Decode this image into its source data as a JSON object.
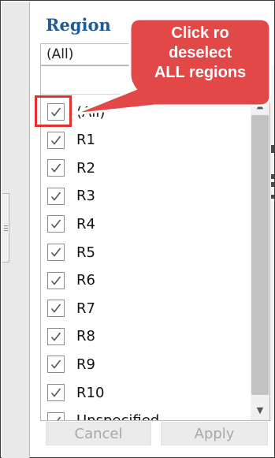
{
  "filter": {
    "title": "Region",
    "selected_value": "(All)"
  },
  "items": [
    {
      "label": "(All)",
      "checked": true
    },
    {
      "label": "R1",
      "checked": true
    },
    {
      "label": "R2",
      "checked": true
    },
    {
      "label": "R3",
      "checked": true
    },
    {
      "label": "R4",
      "checked": true
    },
    {
      "label": "R5",
      "checked": true
    },
    {
      "label": "R6",
      "checked": true
    },
    {
      "label": "R7",
      "checked": true
    },
    {
      "label": "R8",
      "checked": true
    },
    {
      "label": "R9",
      "checked": true
    },
    {
      "label": "R10",
      "checked": true
    },
    {
      "label": "Unspecified",
      "checked": true
    }
  ],
  "buttons": {
    "cancel": "Cancel",
    "apply": "Apply",
    "enabled": false
  },
  "callout": {
    "lines": [
      "Click ro",
      "deselect",
      "ALL regions"
    ]
  },
  "colors": {
    "title": "#1f5a99",
    "callout_fill": "#e24848",
    "callout_border": "#ffffff",
    "highlight": "#e03030"
  },
  "icons": {
    "checkbox": "checkmark-icon",
    "scroll_up": "chevron-up-icon",
    "scroll_down": "chevron-down-icon",
    "grip": "grip-lines-icon"
  }
}
